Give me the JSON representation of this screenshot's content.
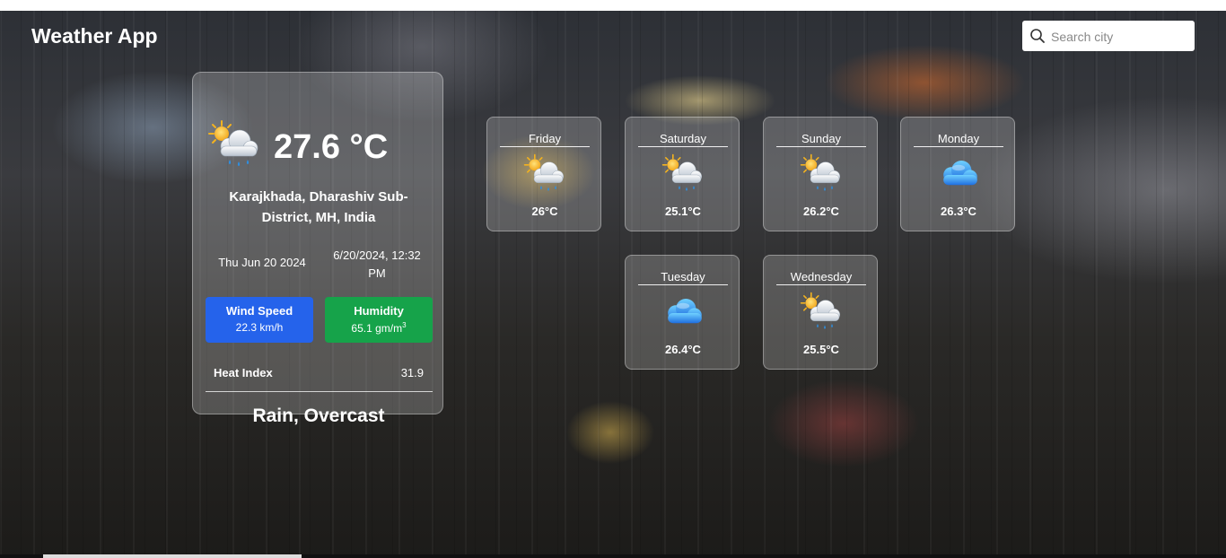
{
  "app": {
    "title": "Weather App"
  },
  "search": {
    "placeholder": "Search city"
  },
  "current": {
    "temperature": "27.6 °C",
    "icon": "sun-behind-rain-cloud-icon",
    "location": "Karajkhada, Dharashiv Sub-District, MH, India",
    "date": "Thu Jun 20 2024",
    "datetime": "6/20/2024, 12:32 PM",
    "wind": {
      "label": "Wind Speed",
      "value": "22.3 km/h",
      "color": "#2563eb"
    },
    "humidity": {
      "label": "Humidity",
      "value": "65.1 gm/m",
      "unit_sup": "3",
      "color": "#16a34a"
    },
    "heat_index": {
      "label": "Heat Index",
      "value": "31.9"
    },
    "condition": "Rain, Overcast"
  },
  "forecast": [
    {
      "day": "Friday",
      "temp": "26°C",
      "icon": "sun-behind-rain-cloud-icon"
    },
    {
      "day": "Saturday",
      "temp": "25.1°C",
      "icon": "sun-behind-rain-cloud-icon"
    },
    {
      "day": "Sunday",
      "temp": "26.2°C",
      "icon": "sun-behind-rain-cloud-icon"
    },
    {
      "day": "Monday",
      "temp": "26.3°C",
      "icon": "blue-cloud-icon"
    },
    {
      "day": "Tuesday",
      "temp": "26.4°C",
      "icon": "blue-cloud-icon"
    },
    {
      "day": "Wednesday",
      "temp": "25.5°C",
      "icon": "sun-behind-rain-cloud-icon"
    }
  ]
}
